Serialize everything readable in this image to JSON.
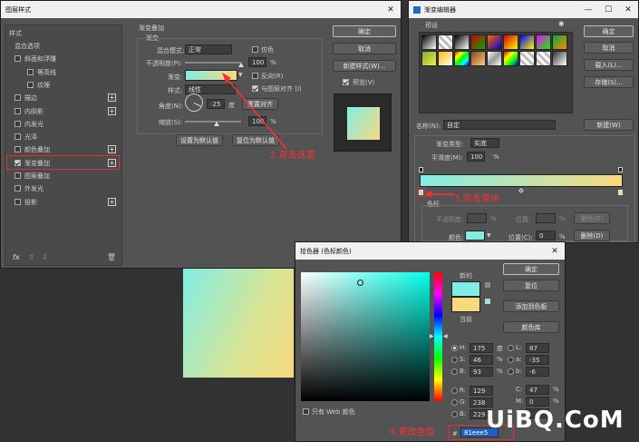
{
  "layer_style": {
    "title": "图层样式",
    "sidebar": {
      "header": "样式",
      "items": [
        {
          "label": "混合选项",
          "check": false,
          "plus": false,
          "indent": false
        },
        {
          "label": "斜面和浮雕",
          "check": true,
          "checked": false,
          "plus": false,
          "indent": false
        },
        {
          "label": "等高线",
          "check": true,
          "checked": false,
          "plus": false,
          "indent": true
        },
        {
          "label": "纹理",
          "check": true,
          "checked": false,
          "plus": false,
          "indent": true
        },
        {
          "label": "描边",
          "check": true,
          "checked": false,
          "plus": true,
          "indent": false
        },
        {
          "label": "内阴影",
          "check": true,
          "checked": false,
          "plus": true,
          "indent": false
        },
        {
          "label": "内发光",
          "check": true,
          "checked": false,
          "plus": false,
          "indent": false
        },
        {
          "label": "光泽",
          "check": true,
          "checked": false,
          "plus": false,
          "indent": false
        },
        {
          "label": "颜色叠加",
          "check": true,
          "checked": false,
          "plus": true,
          "indent": false
        },
        {
          "label": "渐变叠加",
          "check": true,
          "checked": true,
          "plus": true,
          "indent": false
        },
        {
          "label": "图案叠加",
          "check": true,
          "checked": false,
          "plus": false,
          "indent": false
        },
        {
          "label": "外发光",
          "check": true,
          "checked": false,
          "plus": false,
          "indent": false
        },
        {
          "label": "投影",
          "check": true,
          "checked": false,
          "plus": true,
          "indent": false
        }
      ],
      "fx_label": "fx"
    },
    "section_title": "渐变叠加",
    "group_title": "渐变",
    "blend_mode_label": "混合模式:",
    "blend_mode_value": "正常",
    "dither_label": "仿色",
    "opacity_label": "不透明度(P):",
    "opacity_value": "100",
    "opacity_unit": "%",
    "gradient_label": "渐变:",
    "reverse_label": "反向(R)",
    "style_label": "样式:",
    "style_value": "线性",
    "align_label": "与图层对齐 (I)",
    "angle_label": "角度(N):",
    "angle_value": "-25",
    "angle_unit": "度",
    "reset_align_label": "重置对齐",
    "scale_label": "缩放(S):",
    "scale_value": "100",
    "scale_unit": "%",
    "set_default_label": "设置为默认值",
    "reset_default_label": "复位为默认值",
    "ok_label": "确定",
    "cancel_label": "取消",
    "new_style_label": "新建样式(W)...",
    "preview_label": "预览(V)"
  },
  "gradient_editor": {
    "title": "渐变编辑器",
    "presets_label": "预设",
    "gear_icon": "gear-icon",
    "ok_label": "确定",
    "cancel_label": "取消",
    "load_label": "载入(L)...",
    "save_label": "存储(S)...",
    "name_label": "名称(N):",
    "name_value": "自定",
    "new_label": "新建(W)",
    "type_label": "渐变类型:",
    "type_value": "实底",
    "smooth_label": "平滑度(M):",
    "smooth_value": "100",
    "smooth_unit": "%",
    "stops_label": "色标",
    "opacity_label": "不透明度:",
    "location_label": "位置:",
    "delete_label": "删除(D)",
    "color_label": "颜色:",
    "location2_label": "位置(C):",
    "location2_value": "0",
    "percent": "%",
    "delete2_label": "删除(D)"
  },
  "color_picker": {
    "title": "拾色器 (色标颜色)",
    "new_label": "新的",
    "current_label": "当前",
    "ok_label": "确定",
    "reset_label": "复位",
    "add_swatch_label": "添加到色板",
    "color_lib_label": "颜色库",
    "web_only_label": "只有 Web 颜色",
    "hsb": [
      {
        "key": "H:",
        "value": "175",
        "unit": "度"
      },
      {
        "key": "S:",
        "value": "46",
        "unit": "%"
      },
      {
        "key": "B:",
        "value": "93",
        "unit": "%"
      }
    ],
    "rgb": [
      {
        "key": "R:",
        "value": "129"
      },
      {
        "key": "G:",
        "value": "238"
      },
      {
        "key": "B:",
        "value": "229"
      }
    ],
    "lab": [
      {
        "key": "L:",
        "value": "87"
      },
      {
        "key": "a:",
        "value": "-35"
      },
      {
        "key": "b:",
        "value": "-6"
      }
    ],
    "cmyk": [
      {
        "key": "C:",
        "value": "47",
        "unit": "%"
      },
      {
        "key": "M:",
        "value": "0",
        "unit": "%"
      },
      {
        "key": "Y:",
        "value": "",
        "unit": ""
      }
    ],
    "hex_prefix": "#",
    "hex_value": "81eee5",
    "new_color": "#81eee5",
    "current_color": "#f9d97e"
  },
  "annotations": {
    "step2": "2.双击这里",
    "step3": "3.双击滑块",
    "step4": "4.更改色值"
  },
  "watermark": "UiBQ.CoM",
  "colors": {
    "grad_start": "#81eee5",
    "grad_end": "#f9d97e",
    "annotation": "#ff3030"
  }
}
